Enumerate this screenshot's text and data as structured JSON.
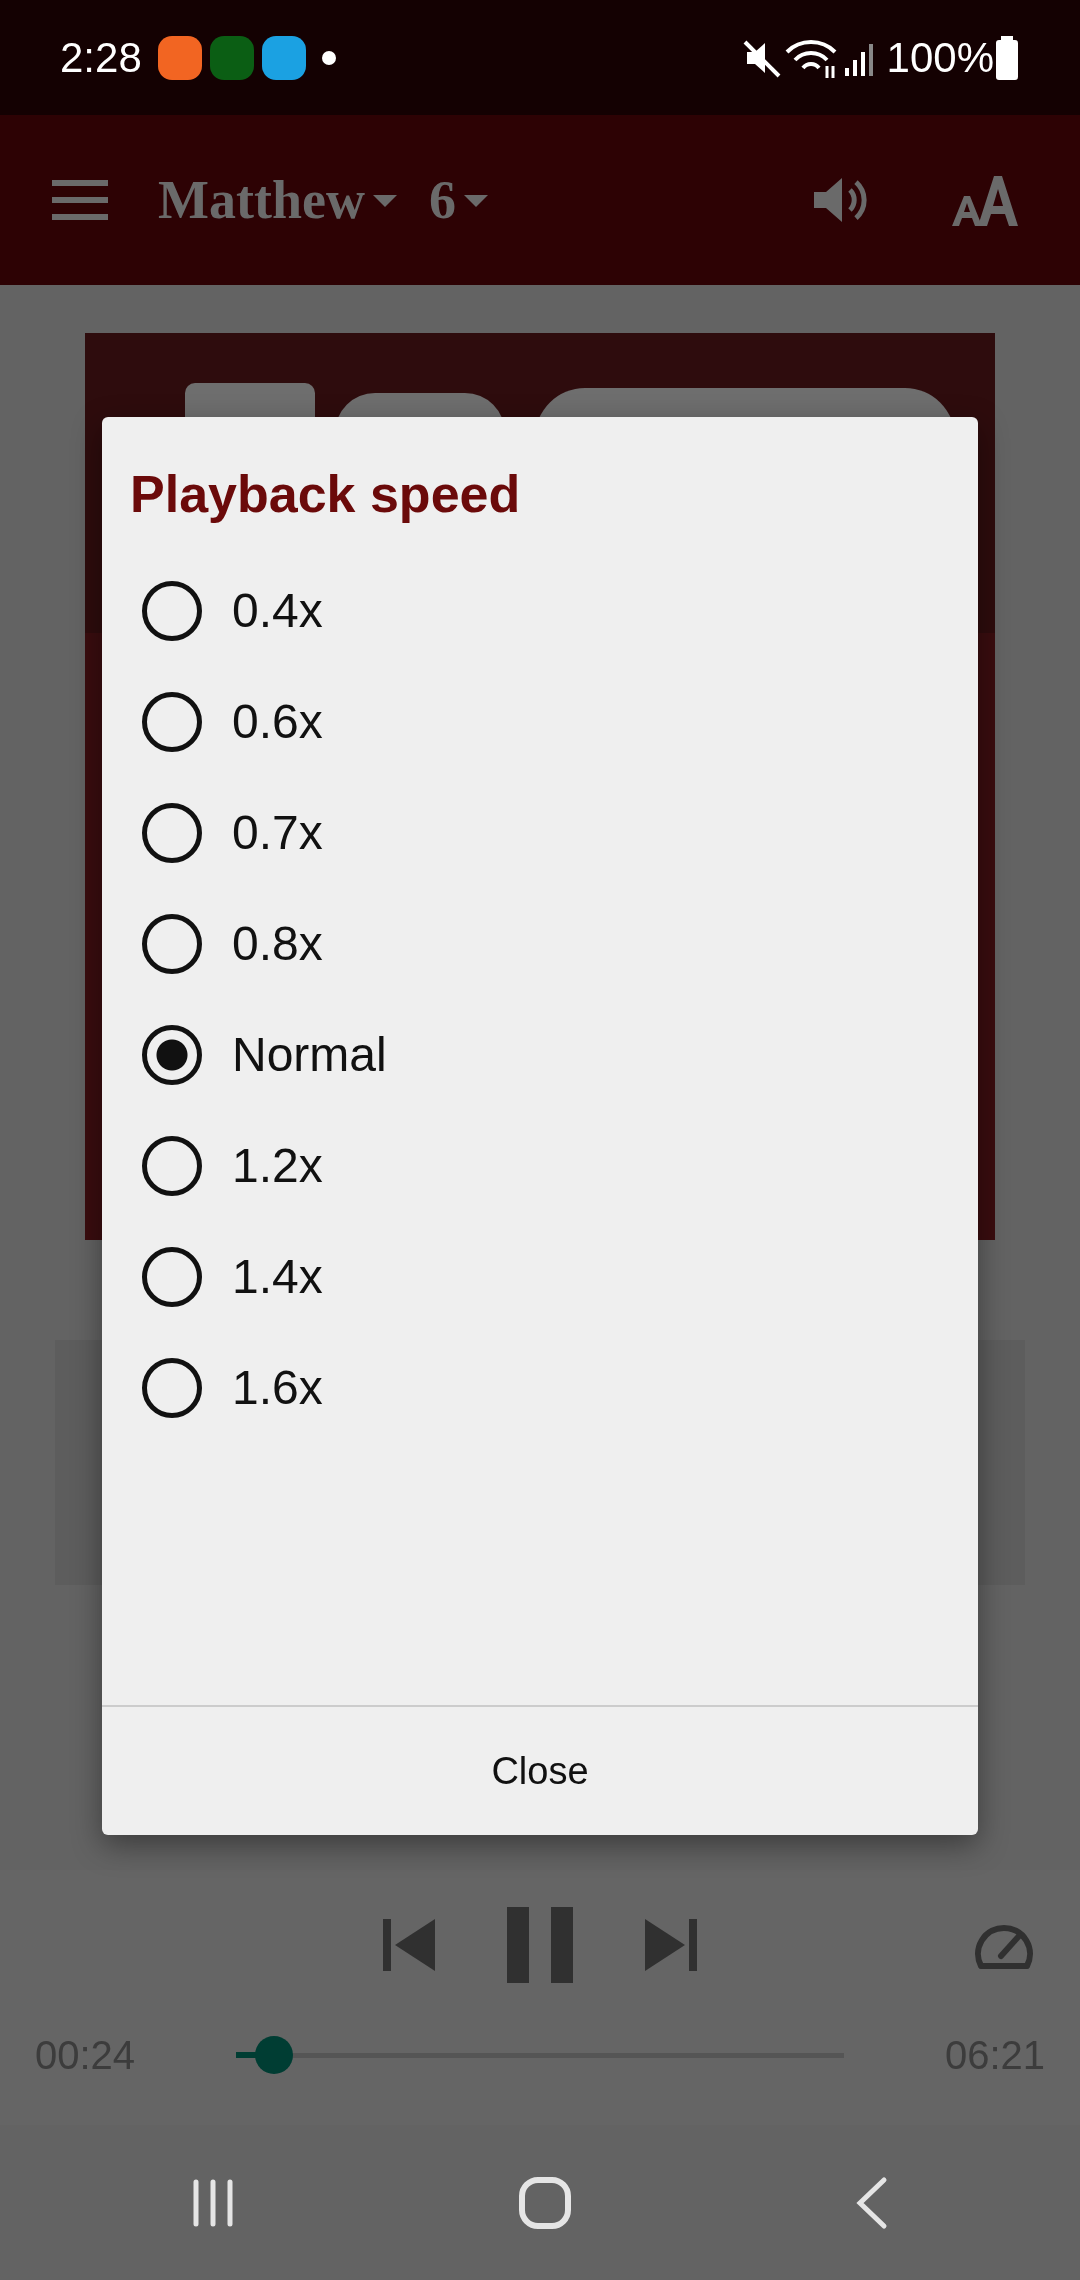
{
  "status_bar": {
    "time": "2:28",
    "battery": "100%"
  },
  "app_bar": {
    "book": "Matthew",
    "chapter": "6"
  },
  "dialog": {
    "title": "Playback speed",
    "options": [
      {
        "label": "0.4x",
        "selected": false
      },
      {
        "label": "0.6x",
        "selected": false
      },
      {
        "label": "0.7x",
        "selected": false
      },
      {
        "label": "0.8x",
        "selected": false
      },
      {
        "label": "Normal",
        "selected": true
      },
      {
        "label": "1.2x",
        "selected": false
      },
      {
        "label": "1.4x",
        "selected": false
      },
      {
        "label": "1.6x",
        "selected": false
      }
    ],
    "close_button": "Close"
  },
  "player": {
    "elapsed": "00:24",
    "duration": "06:21",
    "level": 0.063
  }
}
